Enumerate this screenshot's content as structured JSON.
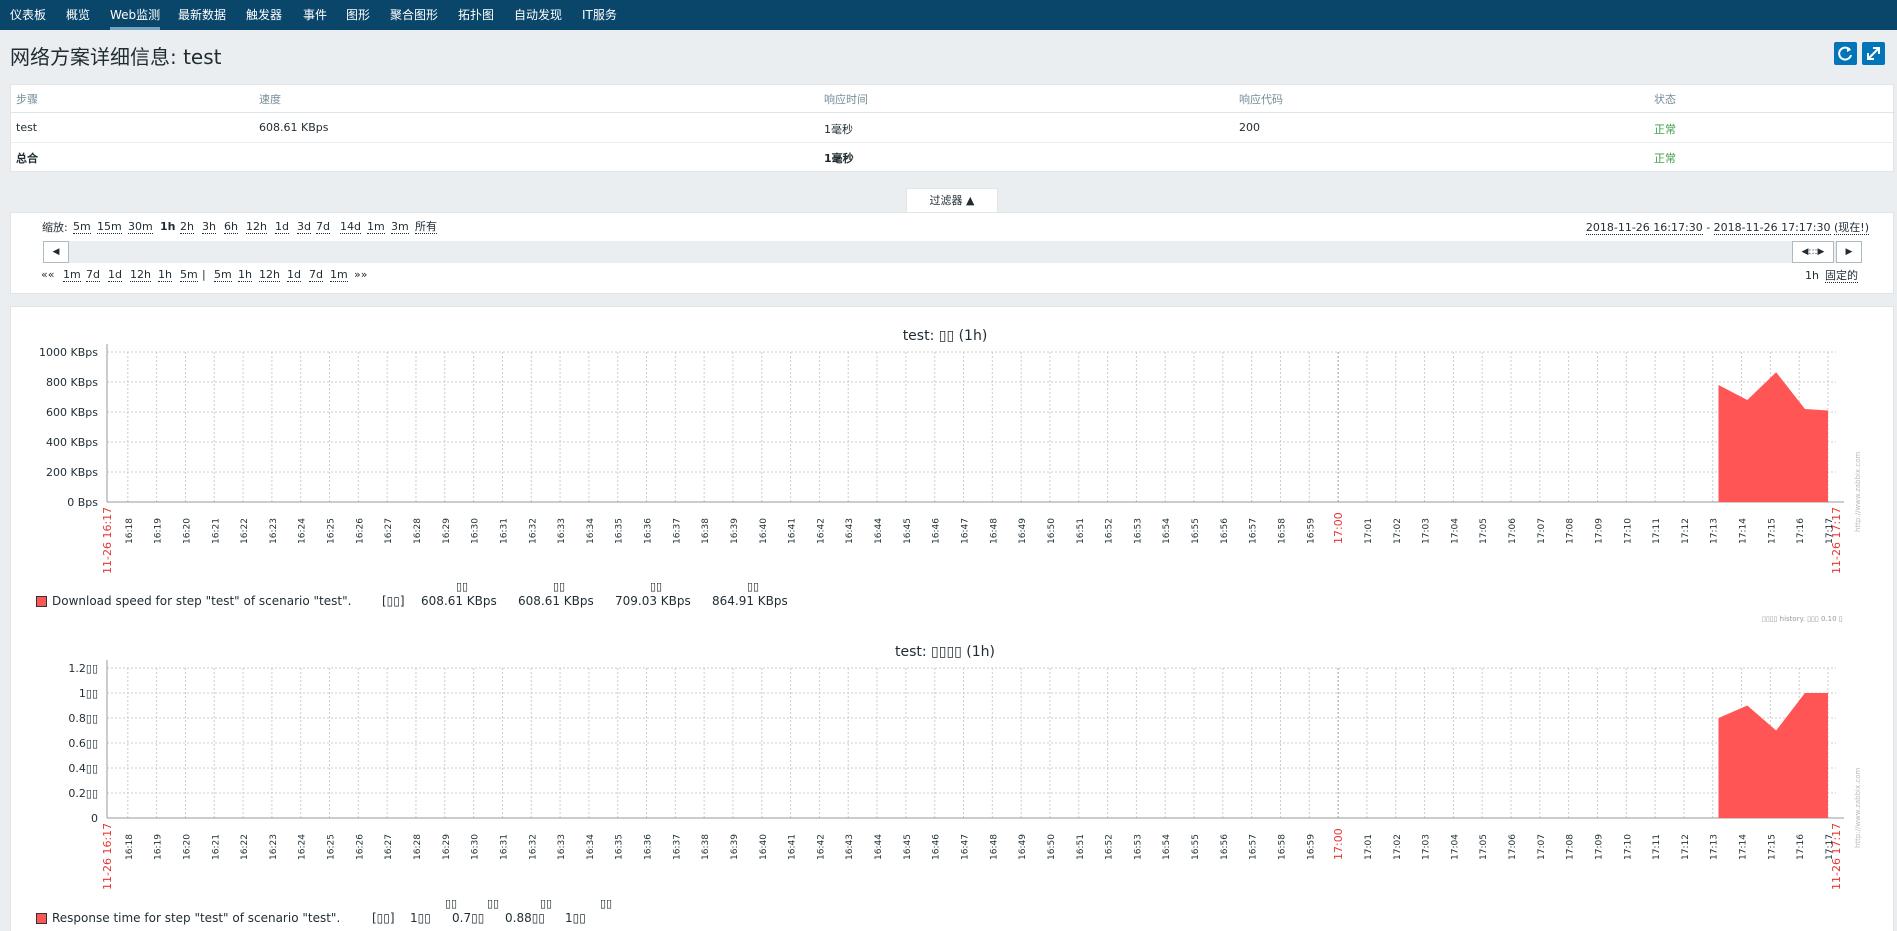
{
  "nav": {
    "items": [
      "仪表板",
      "概览",
      "Web监测",
      "最新数据",
      "触发器",
      "事件",
      "图形",
      "聚合图形",
      "拓扑图",
      "自动发现",
      "IT服务"
    ],
    "active_index": 2
  },
  "page": {
    "title": "网络方案详细信息: test",
    "refresh_icon": "refresh-icon",
    "fullscreen_icon": "fullscreen-icon"
  },
  "details_table": {
    "columns": [
      "步骤",
      "速度",
      "响应时间",
      "响应代码",
      "状态"
    ],
    "rows": [
      [
        "test",
        "608.61 KBps",
        "1毫秒",
        "200",
        "正常"
      ]
    ],
    "total": [
      "总合",
      "",
      "1毫秒",
      "",
      "正常"
    ]
  },
  "filter": {
    "tab_label": "过滤器 ▲",
    "zoom_label": "缩放:",
    "zoom_options": [
      "5m",
      "15m",
      "30m",
      "1h",
      "2h",
      "3h",
      "6h",
      "12h",
      "1d",
      "3d",
      "7d",
      "14d",
      "1m",
      "3m",
      "所有"
    ],
    "zoom_active": "1h",
    "range_start": "2018-11-26 16:17:30",
    "range_sep": " - ",
    "range_end": "2018-11-26 17:17:30",
    "range_now": "(现在!)",
    "back_prefix": "««",
    "back_options": [
      "1m",
      "7d",
      "1d",
      "12h",
      "1h",
      "5m"
    ],
    "separator": "|",
    "fwd_options": [
      "5m",
      "1h",
      "12h",
      "1d",
      "7d",
      "1m"
    ],
    "fwd_suffix": "»»",
    "period_label": "1h",
    "fixed_label": "固定的",
    "left_arrow": "◀",
    "right_arrow": "▶",
    "slider_handle": "◀:::▶"
  },
  "charts_common": {
    "x_tick_labels": [
      "16:18",
      "16:19",
      "16:20",
      "16:21",
      "16:22",
      "16:23",
      "16:24",
      "16:25",
      "16:26",
      "16:27",
      "16:28",
      "16:29",
      "16:30",
      "16:31",
      "16:32",
      "16:33",
      "16:34",
      "16:35",
      "16:36",
      "16:37",
      "16:38",
      "16:39",
      "16:40",
      "16:41",
      "16:42",
      "16:43",
      "16:44",
      "16:45",
      "16:46",
      "16:47",
      "16:48",
      "16:49",
      "16:50",
      "16:51",
      "16:52",
      "16:53",
      "16:54",
      "16:55",
      "16:56",
      "16:57",
      "16:58",
      "16:59",
      "17:00",
      "17:01",
      "17:02",
      "17:03",
      "17:04",
      "17:05",
      "17:06",
      "17:07",
      "17:08",
      "17:09",
      "17:10",
      "17:11",
      "17:12",
      "17:13",
      "17:14",
      "17:15",
      "17:16",
      "17:17"
    ],
    "x_start_label": "11-26 16:17",
    "x_end_label": "11-26 17:17",
    "highlight_tick": "17:00",
    "watermark": "http://www.zabbix.com",
    "series_color": "#ff5555",
    "accent_red": "#e33734"
  },
  "chart_data": [
    {
      "type": "area",
      "title": "test: \u0000\u0000 (1h)",
      "title_text": "test: ▯▯ (1h)",
      "y_tick_labels": [
        "1000 KBps",
        "800 KBps",
        "600 KBps",
        "400 KBps",
        "200 KBps",
        "0 Bps"
      ],
      "ylim": [
        0,
        1000
      ],
      "y_unit": "KBps",
      "x": [
        "17:13",
        "17:14",
        "17:15",
        "17:16",
        "17:17"
      ],
      "series": [
        {
          "name": "Download speed for step \"test\" of scenario \"test\".",
          "x": [
            56.2,
            57.2,
            58.2,
            59.2,
            60.0
          ],
          "values": [
            780,
            680,
            865,
            620,
            610
          ]
        }
      ],
      "legend": {
        "label": "Download speed for step \"test\" of scenario \"test\".",
        "func": "[▯▯]",
        "stat_headers": [
          "▯▯",
          "▯▯",
          "▯▯",
          "▯▯"
        ],
        "stats": [
          "608.61 KBps",
          "608.61 KBps",
          "709.03 KBps",
          "864.91 KBps"
        ]
      },
      "footer_note": "▯▯▯▯ history. ▯▯▯ 0.10 ▯"
    },
    {
      "type": "area",
      "title_text": "test: ▯▯▯▯ (1h)",
      "y_tick_labels": [
        "1.2▯▯",
        "1▯▯",
        "0.8▯▯",
        "0.6▯▯",
        "0.4▯▯",
        "0.2▯▯",
        "0"
      ],
      "ylim": [
        0,
        1.2
      ],
      "y_unit": "▯▯",
      "x": [
        "17:13",
        "17:14",
        "17:15",
        "17:16",
        "17:17"
      ],
      "series": [
        {
          "name": "Response time for step \"test\" of scenario \"test\".",
          "x": [
            56.2,
            57.2,
            58.2,
            59.2,
            60.0
          ],
          "values": [
            0.8,
            0.9,
            0.7,
            1.0,
            1.0
          ]
        }
      ],
      "legend": {
        "label": "Response time for step \"test\" of scenario \"test\".",
        "func": "[▯▯]",
        "stat_headers": [
          "▯▯",
          "▯▯",
          "▯▯",
          "▯▯"
        ],
        "stats": [
          "1▯▯",
          "0.7▯▯",
          "0.88▯▯",
          "1▯▯"
        ]
      }
    }
  ]
}
